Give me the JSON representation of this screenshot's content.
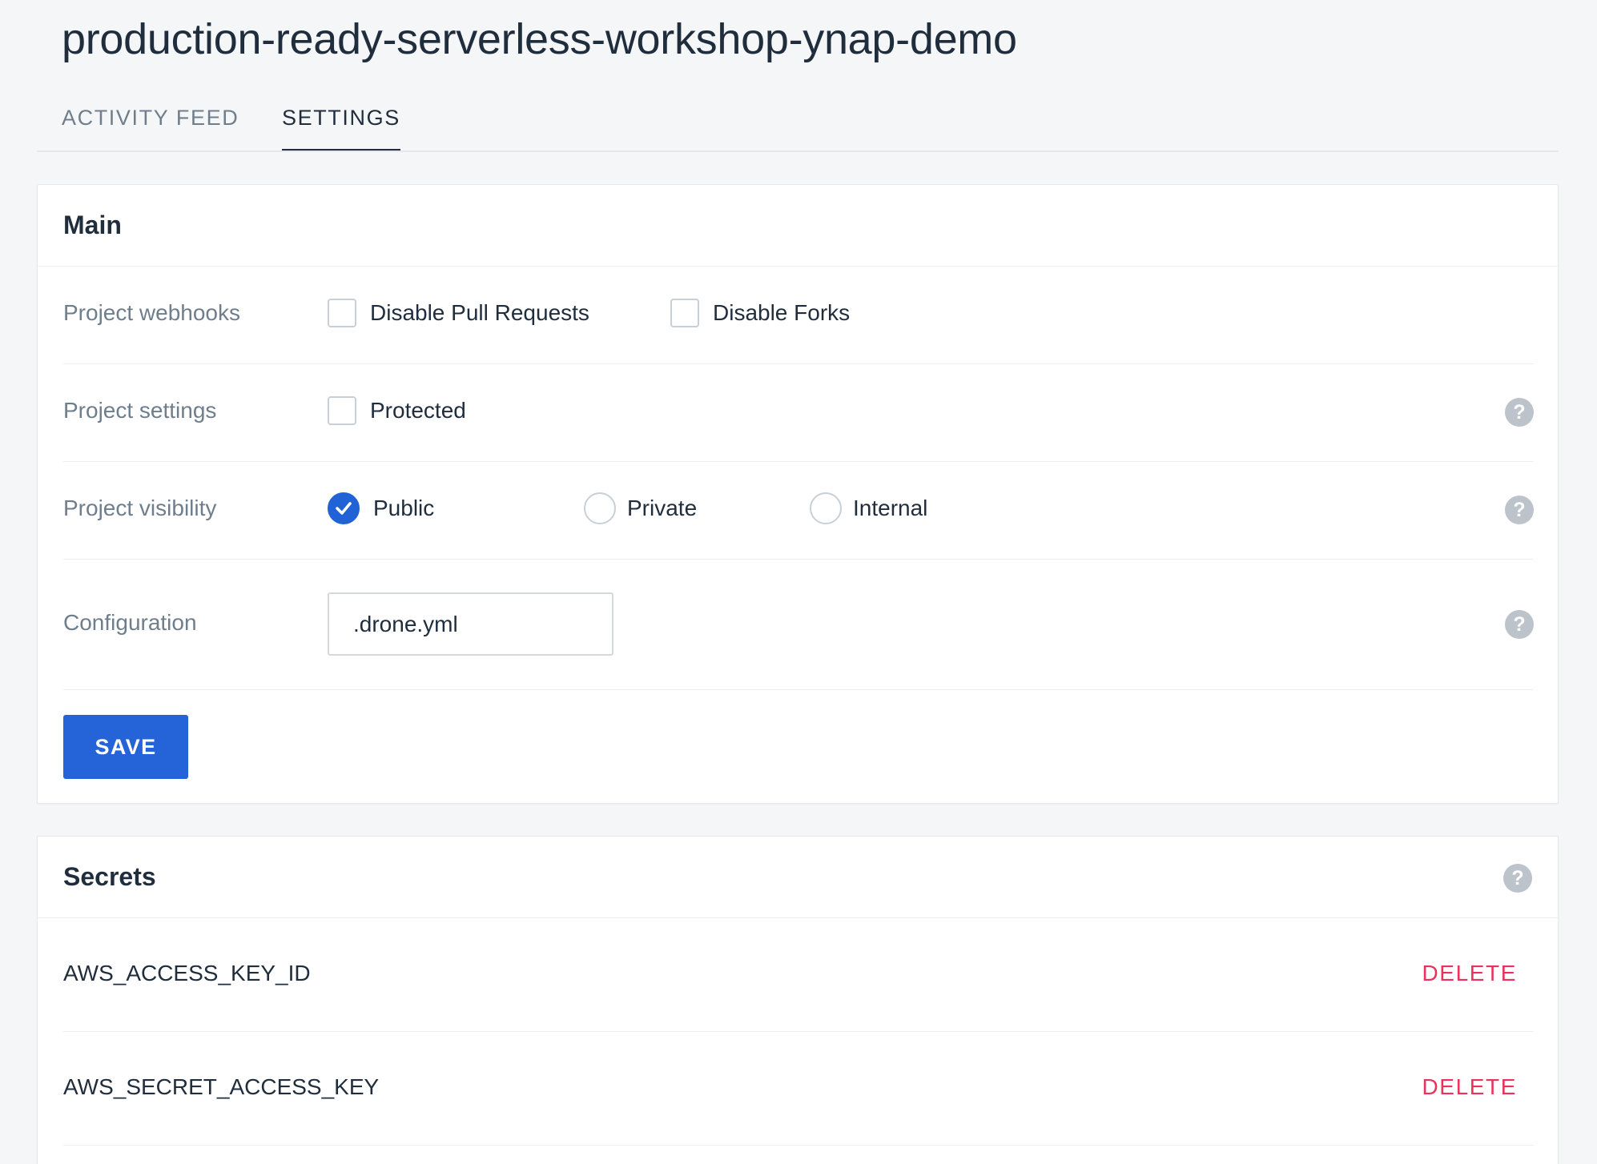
{
  "repo": {
    "title": "production-ready-serverless-workshop-ynap-demo"
  },
  "tabs": [
    {
      "label": "ACTIVITY FEED",
      "active": false
    },
    {
      "label": "SETTINGS",
      "active": true
    }
  ],
  "main": {
    "title": "Main",
    "webhooks": {
      "label": "Project webhooks",
      "disable_pull_requests": {
        "label": "Disable Pull Requests",
        "checked": false
      },
      "disable_forks": {
        "label": "Disable Forks",
        "checked": false
      }
    },
    "settings": {
      "label": "Project settings",
      "protected": {
        "label": "Protected",
        "checked": false
      },
      "help_icon": "question-circle-icon"
    },
    "visibility": {
      "label": "Project visibility",
      "options": [
        {
          "label": "Public",
          "selected": true
        },
        {
          "label": "Private",
          "selected": false
        },
        {
          "label": "Internal",
          "selected": false
        }
      ],
      "help_icon": "question-circle-icon"
    },
    "configuration": {
      "label": "Configuration",
      "value": ".drone.yml",
      "help_icon": "question-circle-icon"
    },
    "save_label": "SAVE"
  },
  "secrets": {
    "title": "Secrets",
    "help_icon": "question-circle-icon",
    "items": [
      {
        "name": "AWS_ACCESS_KEY_ID",
        "action": "DELETE"
      },
      {
        "name": "AWS_SECRET_ACCESS_KEY",
        "action": "DELETE"
      }
    ]
  },
  "colors": {
    "primary": "#2563d8",
    "danger": "#e8345c",
    "text": "#1f2d3d",
    "muted": "#6f7e8c",
    "background": "#f5f6f8"
  }
}
